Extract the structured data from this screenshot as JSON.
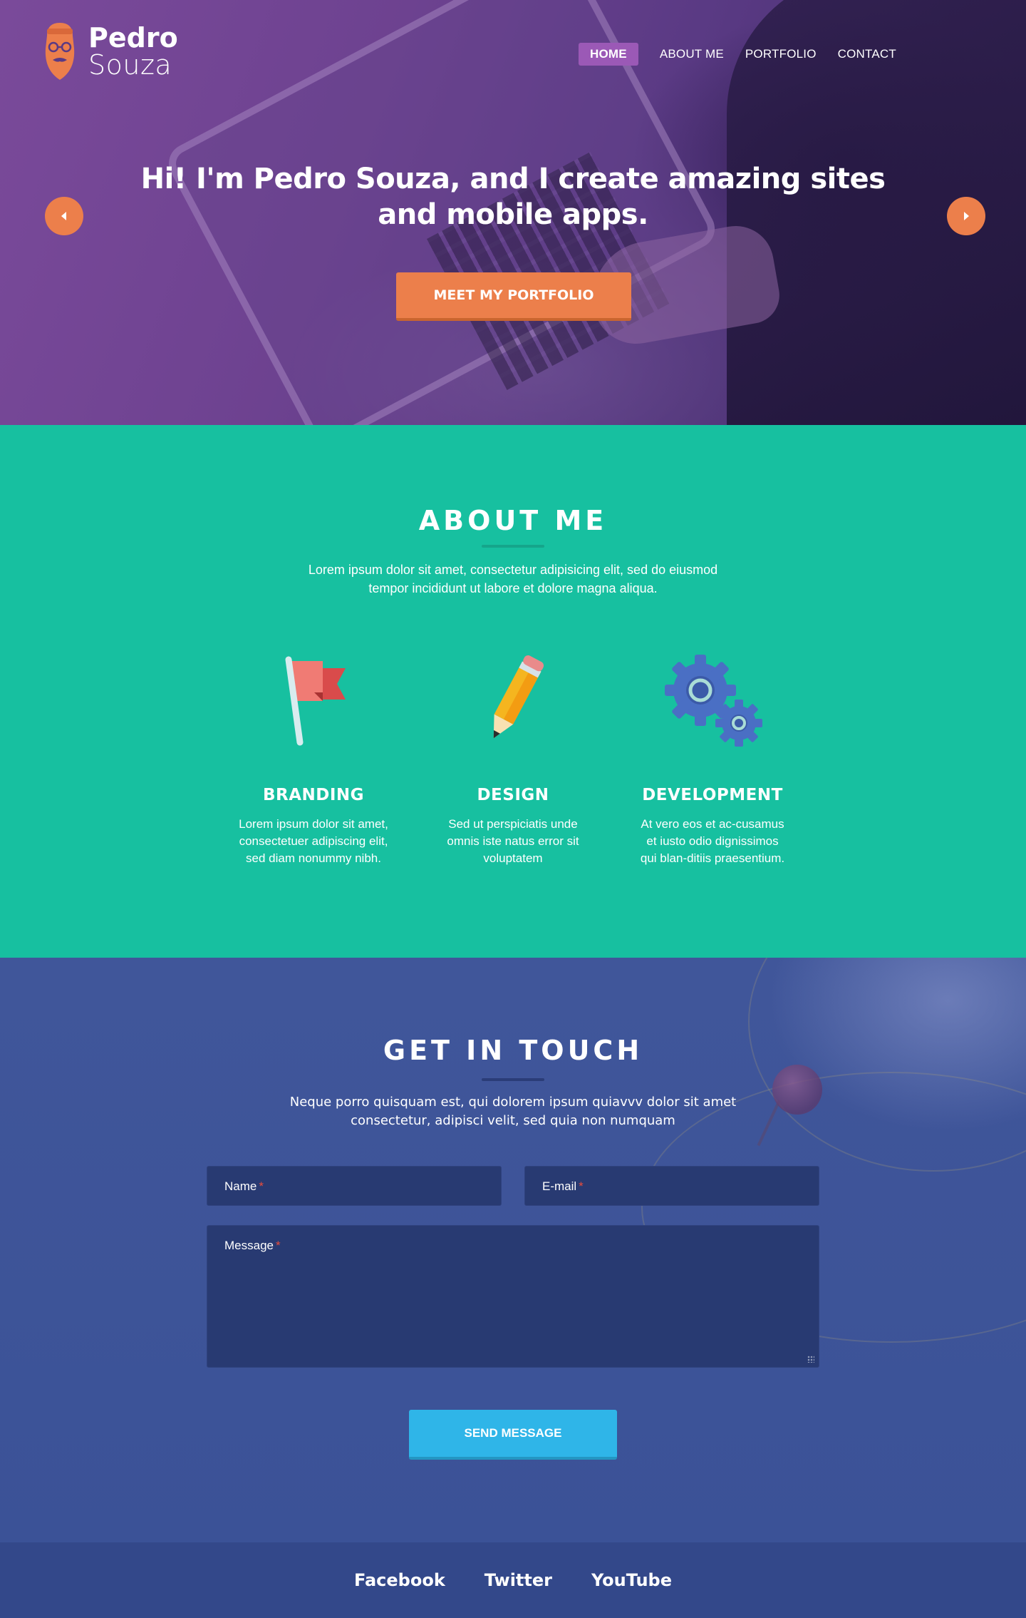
{
  "brand": {
    "first": "Pedro",
    "last": "Souza",
    "accent": "#ec7f4b"
  },
  "nav": {
    "items": [
      {
        "label": "HOME",
        "active": true
      },
      {
        "label": "ABOUT ME"
      },
      {
        "label": "PORTFOLIO"
      },
      {
        "label": "CONTACT"
      }
    ]
  },
  "hero": {
    "title": "Hi! I'm Pedro Souza, and I create amazing sites and mobile apps.",
    "button": "MEET MY PORTFOLIO",
    "prev_icon": "chevron-left-icon",
    "next_icon": "chevron-right-icon"
  },
  "about": {
    "title": "ABOUT ME",
    "description": "Lorem ipsum dolor sit amet, consectetur adipisicing elit, sed do eiusmod tempor incididunt ut labore et dolore magna aliqua.",
    "background": "#17c0a0",
    "features": [
      {
        "icon": "flag-icon",
        "title": "BRANDING",
        "text": "Lorem ipsum dolor sit amet, consectetuer adipiscing elit, sed diam nonummy nibh."
      },
      {
        "icon": "pencil-icon",
        "title": "DESIGN",
        "text": "Sed ut perspiciatis unde omnis iste natus error sit voluptatem"
      },
      {
        "icon": "gears-icon",
        "title": "DEVELOPMENT",
        "text": "At vero eos et ac-cusamus et iusto odio dignissimos qui blan-ditiis praesentium."
      }
    ]
  },
  "contact": {
    "title": "GET IN TOUCH",
    "description": "Neque porro quisquam est, qui dolorem ipsum quiavvv dolor sit amet consectetur, adipisci velit, sed quia non numquam",
    "fields": {
      "name": {
        "placeholder": "Name",
        "required": "*"
      },
      "email": {
        "placeholder": "E-mail",
        "required": "*"
      },
      "message": {
        "placeholder": "Message",
        "required": "*"
      }
    },
    "button": "SEND MESSAGE",
    "button_color": "#2fb5e8"
  },
  "footer": {
    "links": [
      {
        "label": "Facebook"
      },
      {
        "label": "Twitter"
      },
      {
        "label": "YouTube"
      }
    ]
  }
}
